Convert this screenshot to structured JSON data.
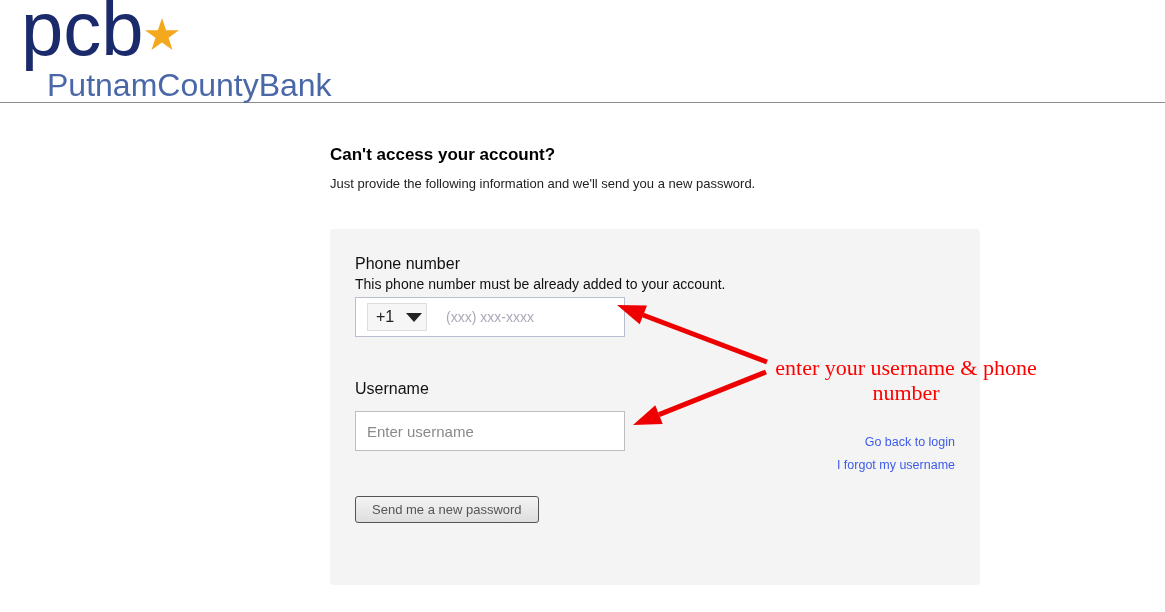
{
  "header": {
    "logo": {
      "monogram": "pcb",
      "name": "PutnamCountyBank"
    }
  },
  "title": "Can't access your account?",
  "subtitle": "Just provide the following information and we'll send you a new password.",
  "form": {
    "phone": {
      "label": "Phone number",
      "hint": "This phone number must be already added to your account.",
      "country_code": "+1",
      "placeholder": "(xxx) xxx-xxxx"
    },
    "username": {
      "label": "Username",
      "placeholder": "Enter username"
    },
    "links": [
      "Go back to login",
      "I forgot my username"
    ],
    "submit": "Send me a new password"
  },
  "annotation": {
    "text": "enter your username & phone number"
  }
}
